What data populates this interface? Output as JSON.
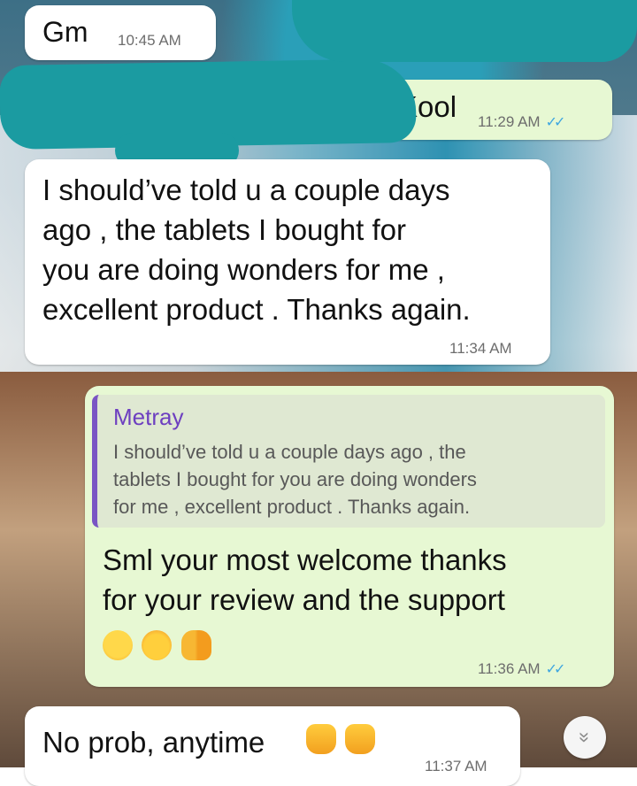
{
  "messages": [
    {
      "direction": "incoming",
      "text": "Gm",
      "time": "10:45 AM"
    },
    {
      "direction": "outgoing",
      "text": "Kool",
      "time": "11:29 AM",
      "status": "read"
    },
    {
      "direction": "incoming",
      "text": "I should've told u a couple days ago , the tablets I bought for you  are doing wonders for me , excellent product . Thanks again.",
      "lines": [
        "I should’ve told u a couple days",
        "ago , the tablets I bought for",
        "you  are doing wonders for me ,",
        "excellent product . Thanks again."
      ],
      "time": "11:34 AM"
    },
    {
      "direction": "outgoing",
      "quote": {
        "author": "Metray",
        "lines": [
          "I should’ve told u a couple days ago , the",
          "tablets I bought for you  are doing wonders",
          "for me , excellent product . Thanks again."
        ]
      },
      "lines": [
        "Sml your most welcome thanks",
        "for your review and the support"
      ],
      "emojis": [
        "smiling-face-emoji",
        "party-face-emoji",
        "raised-hands-emoji"
      ],
      "time": "11:36 AM",
      "status": "read"
    },
    {
      "direction": "incoming",
      "text": "No prob, anytime",
      "emojis": [
        "thumbs-up-emoji",
        "thumbs-up-emoji"
      ],
      "time": "11:37 AM"
    }
  ],
  "scroll_button": {
    "icon": "double-chevron-down-icon",
    "glyph": "»"
  },
  "colors": {
    "incoming_bubble": "#ffffff",
    "outgoing_bubble": "#e7f8d3",
    "quote_bar": "#7a55c4",
    "quote_author": "#6d3fc0",
    "read_ticks": "#3ea6e0",
    "redaction": "#1b9ba1"
  }
}
